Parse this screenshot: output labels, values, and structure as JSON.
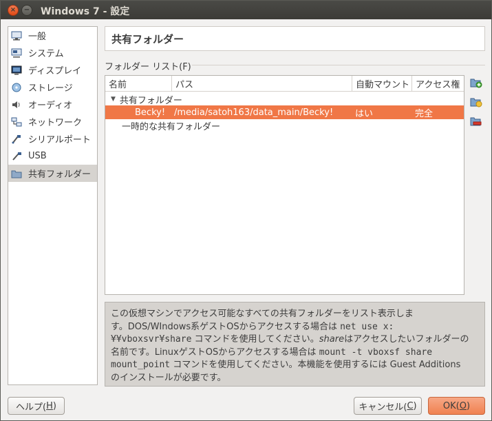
{
  "window": {
    "title": "Windows 7 - 設定",
    "close_glyph": "×",
    "minimize_glyph": "−"
  },
  "sidebar": {
    "items": [
      {
        "label": "一般",
        "icon": "general-icon"
      },
      {
        "label": "システム",
        "icon": "system-icon"
      },
      {
        "label": "ディスプレイ",
        "icon": "display-icon"
      },
      {
        "label": "ストレージ",
        "icon": "storage-icon"
      },
      {
        "label": "オーディオ",
        "icon": "audio-icon"
      },
      {
        "label": "ネットワーク",
        "icon": "network-icon"
      },
      {
        "label": "シリアルポート",
        "icon": "serial-port-icon"
      },
      {
        "label": "USB",
        "icon": "usb-icon"
      },
      {
        "label": "共有フォルダー",
        "icon": "shared-folder-icon",
        "selected": true
      }
    ]
  },
  "main": {
    "title": "共有フォルダー",
    "list_label": "フォルダー リスト(F)",
    "table": {
      "columns": [
        "名前",
        "パス",
        "自動マウント",
        "アクセス権"
      ],
      "group1": {
        "label": "共有フォルダー",
        "expander": "▼"
      },
      "selected_row": {
        "name": "Becky!",
        "path": "/media/satoh163/data_main/Becky!",
        "automount": "はい",
        "access": "完全"
      },
      "group2": {
        "label": "一時的な共有フォルダー"
      }
    },
    "info": {
      "p1": "この仮想マシンでアクセス可能なすべての共有フォルダーをリスト表示しま",
      "p2a": "す。DOS/WIndows系ゲストOSからアクセスする場合は ",
      "p2b": "net use x:",
      "p3a": "¥¥vboxsvr¥share",
      "p3b": " コマンドを使用してください。",
      "p3c": "share",
      "p3d": "はアクセスしたいフォルダーの",
      "p4a": "名前です。LinuxゲストOSからアクセスする場合は ",
      "p4b": "mount -t vboxsf share",
      "p5a": "mount_point",
      "p5b": " コマンドを使用してください。本機能を使用するには Guest Additions",
      "p6": "のインストールが必要です。"
    }
  },
  "buttons": {
    "help": {
      "label": "ヘルプ(",
      "key": "H",
      "suffix": ")"
    },
    "cancel": {
      "label": "キャンセル(",
      "key": "C",
      "suffix": ")"
    },
    "ok": {
      "label": "OK(",
      "key": "O",
      "suffix": ")"
    }
  },
  "colors": {
    "selection": "#f07746",
    "ok_button": "#f08150"
  }
}
